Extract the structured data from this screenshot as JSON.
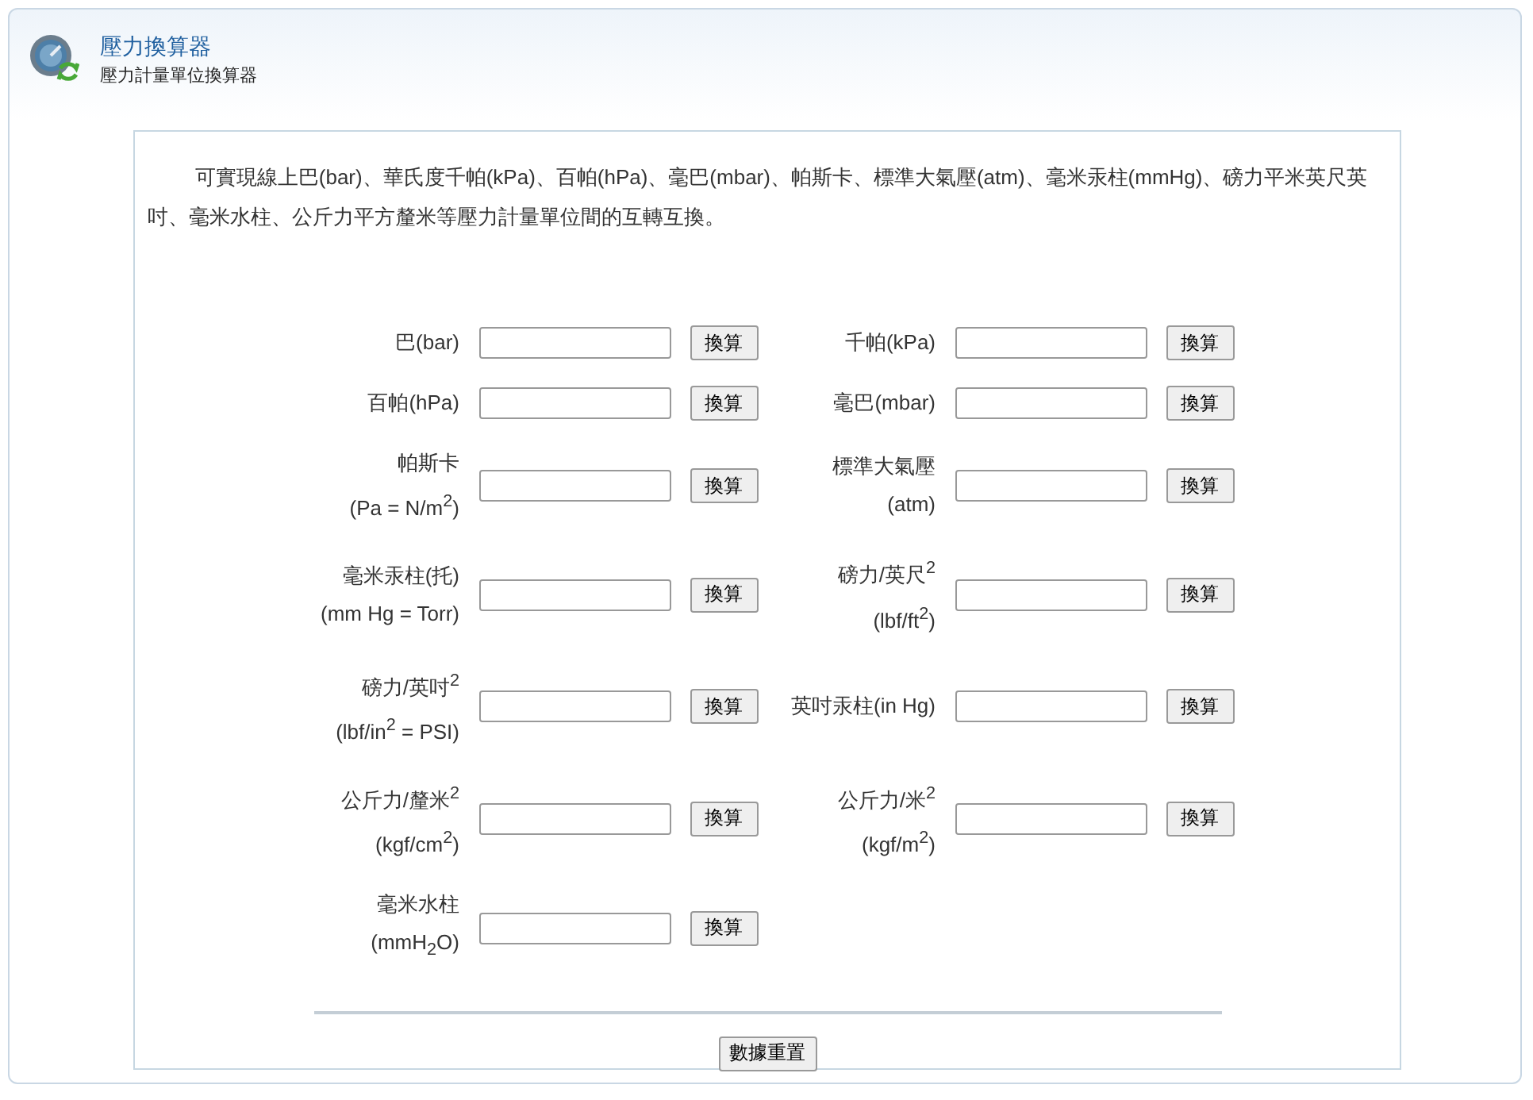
{
  "header": {
    "title": "壓力換算器",
    "subtitle": "壓力計量單位換算器"
  },
  "intro": "可實現線上巴(bar)、華氏度千帕(kPa)、百帕(hPa)、毫巴(mbar)、帕斯卡、標準大氣壓(atm)、毫米汞柱(mmHg)、磅力平米英尺英吋、毫米水柱、公斤力平方釐米等壓力計量單位間的互轉互換。",
  "converters": [
    {
      "label": [
        "巴(bar)"
      ],
      "button": "換算"
    },
    {
      "label": [
        "千帕(kPa)"
      ],
      "button": "換算"
    },
    {
      "label": [
        "百帕(hPa)"
      ],
      "button": "換算"
    },
    {
      "label": [
        "毫巴(mbar)"
      ],
      "button": "換算"
    },
    {
      "label": [
        "帕斯卡",
        "(Pa = N/m$^{2}$)"
      ],
      "button": "換算"
    },
    {
      "label": [
        "標準大氣壓",
        "(atm)"
      ],
      "button": "換算"
    },
    {
      "label": [
        "毫米汞柱(托)",
        "(mm Hg = Torr)"
      ],
      "button": "換算"
    },
    {
      "label": [
        "磅力/英尺$^{2}$",
        "(lbf/ft$^{2}$)"
      ],
      "button": "換算"
    },
    {
      "label": [
        "磅力/英吋$^{2}$",
        "(lbf/in$^{2}$ = PSI)"
      ],
      "button": "換算"
    },
    {
      "label": [
        "英吋汞柱(in Hg)"
      ],
      "button": "換算"
    },
    {
      "label": [
        "公斤力/釐米$^{2}$",
        "(kgf/cm$^{2}$)"
      ],
      "button": "換算"
    },
    {
      "label": [
        "公斤力/米$^{2}$",
        "(kgf/m$^{2}$)"
      ],
      "button": "換算"
    },
    {
      "label": [
        "毫米水柱",
        "(mmH$_{2}$O)"
      ],
      "button": "換算"
    }
  ],
  "reset_button": "數據重置"
}
